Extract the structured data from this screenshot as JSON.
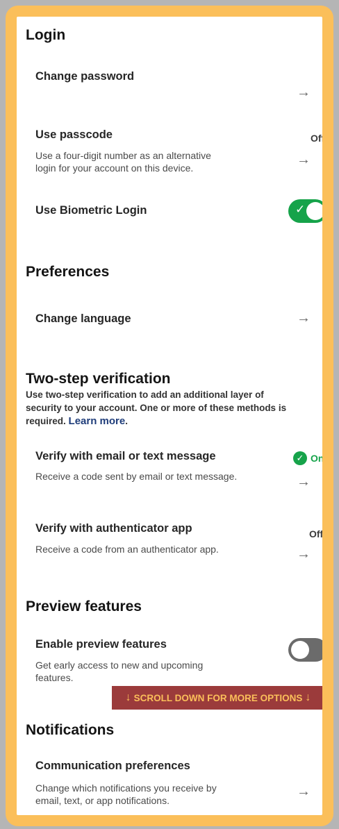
{
  "login": {
    "title": "Login",
    "change_password": {
      "label": "Change password"
    },
    "use_passcode": {
      "label": "Use passcode",
      "status": "Off",
      "description": [
        "Use a four-digit number as an alternative",
        "login for your account on this device."
      ]
    },
    "biometric": {
      "label": "Use Biometric Login",
      "enabled": true
    }
  },
  "preferences": {
    "title": "Preferences",
    "change_language": {
      "label": "Change language"
    }
  },
  "two_step": {
    "title": "Two-step verification",
    "intro": [
      "Use two-step verification to add an additional layer of",
      "security to your account. One or more of these methods is",
      "required."
    ],
    "learn_more": "Learn more",
    "learn_more_suffix": ".",
    "email_sms": {
      "label": "Verify with email or text message",
      "status": "On",
      "description": "Receive a code sent by email or text message."
    },
    "authenticator": {
      "label": "Verify with authenticator app",
      "status": "Off",
      "description": "Receive a code from an authenticator app."
    }
  },
  "preview": {
    "title": "Preview features",
    "enable": {
      "label": "Enable preview features",
      "enabled": false,
      "description": [
        "Get early access to new and upcoming",
        "features."
      ]
    }
  },
  "banner": {
    "text": "SCROLL DOWN FOR MORE OPTIONS"
  },
  "notifications": {
    "title": "Notifications",
    "communication": {
      "label": "Communication preferences",
      "description": [
        "Change which notifications you receive by",
        "email, text, or app notifications."
      ]
    }
  },
  "icons": {
    "arrow": "arrow-right-icon",
    "check": "checkmark-icon",
    "scroll": "arrow-down-icon"
  },
  "colors": {
    "frame": "#fbbf5a",
    "toggle_on": "#16a34a",
    "toggle_off": "#6b6b6b",
    "banner_bg": "#9b3b3b",
    "link": "#1f3d7a"
  }
}
